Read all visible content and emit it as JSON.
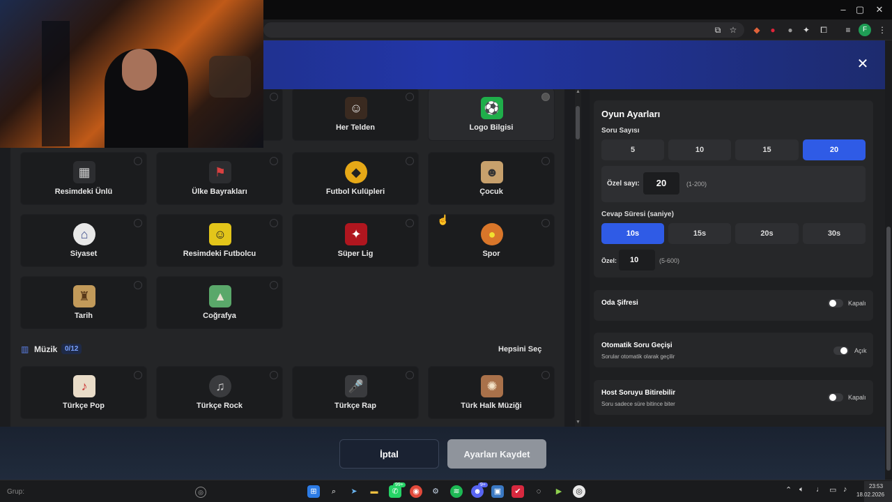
{
  "browser": {
    "window_controls": [
      "–",
      "▢",
      "✕"
    ],
    "tray_icons": [
      "install-icon",
      "star-icon",
      "ext1-icon",
      "ext2-icon",
      "ext3-icon",
      "ext4-icon",
      "puzzle-icon",
      "media-icon",
      "profile-icon",
      "menu-icon"
    ],
    "profile_letter": "F"
  },
  "modal": {
    "close": "✕"
  },
  "categories": {
    "row0": [
      {
        "label": "Her Telden",
        "icon": "person-icon",
        "color": "#3a2a20",
        "glyph": "☺"
      },
      {
        "label": "Logo Bilgisi",
        "icon": "logo-quiz-icon",
        "color": "#1fae4a",
        "glyph": "⚽"
      }
    ],
    "row1": [
      {
        "label": "Resimdeki Ünlü",
        "icon": "building-icon",
        "color": "#2c2d30",
        "glyph": "▦"
      },
      {
        "label": "Ülke Bayrakları",
        "icon": "flag-icon",
        "color": "#2c2d30",
        "glyph": "⚑"
      },
      {
        "label": "Futbol Kulüpleri",
        "icon": "wolf-crest-icon",
        "color": "#e6a817",
        "glyph": "◆"
      },
      {
        "label": "Çocuk",
        "icon": "child-icon",
        "color": "#c7a06c",
        "glyph": "☻"
      }
    ],
    "row2": [
      {
        "label": "Siyaset",
        "icon": "capitol-icon",
        "color": "#e8e8e8",
        "glyph": "⌂"
      },
      {
        "label": "Resimdeki Futbolcu",
        "icon": "footballer-icon",
        "color": "#e3c51a",
        "glyph": "☺"
      },
      {
        "label": "Süper Lig",
        "icon": "super-lig-icon",
        "color": "#b0161f",
        "glyph": "✦"
      },
      {
        "label": "Spor",
        "icon": "sport-balls-icon",
        "color": "#d9762a",
        "glyph": "●"
      }
    ],
    "row3": [
      {
        "label": "Tarih",
        "icon": "colosseum-icon",
        "color": "#c29a5a",
        "glyph": "♜"
      },
      {
        "label": "Coğrafya",
        "icon": "mountain-icon",
        "color": "#5aa86a",
        "glyph": "▲"
      }
    ],
    "music_header": {
      "title": "Müzik",
      "count": "0/12",
      "select_all": "Hepsini Seç"
    },
    "music": [
      {
        "label": "Türkçe Pop",
        "icon": "pop-icon",
        "color": "#e9dcc8",
        "glyph": "♪"
      },
      {
        "label": "Türkçe Rock",
        "icon": "rock-icon",
        "color": "#3a3b3e",
        "glyph": "♫"
      },
      {
        "label": "Türkçe Rap",
        "icon": "microphone-icon",
        "color": "#3a3b3e",
        "glyph": "🎤"
      },
      {
        "label": "Türk Halk Müziği",
        "icon": "folk-icon",
        "color": "#a9714a",
        "glyph": "✺"
      }
    ]
  },
  "settings": {
    "title": "Oyun Ayarları",
    "question_count_label": "Soru Sayısı",
    "question_options": [
      "5",
      "10",
      "15",
      "20"
    ],
    "question_selected": "20",
    "custom_count_label": "Özel sayı:",
    "custom_count_value": "20",
    "custom_count_range": "(1-200)",
    "answer_time_label": "Cevap Süresi (saniye)",
    "time_options": [
      "10s",
      "15s",
      "20s",
      "30s"
    ],
    "time_selected": "10s",
    "custom_time_label": "Özel:",
    "custom_time_value": "10",
    "custom_time_range": "(5-600)",
    "room_password": {
      "label": "Oda Şifresi",
      "state": "Kapalı"
    },
    "auto_next": {
      "label": "Otomatik Soru Geçişi",
      "desc": "Sorular otomatik olarak geçilir",
      "state": "Açık"
    },
    "host_end": {
      "label": "Host Soruyu Bitirebilir",
      "desc": "Soru sadece süre bitince biter",
      "state": "Kapalı"
    }
  },
  "footer": {
    "cancel": "İptal",
    "save": "Ayarları Kaydet"
  },
  "taskbar": {
    "search_placeholder": "Grup:",
    "time": "23:53",
    "date": "18.02.2026",
    "badge_whatsapp": "99+",
    "badge_discord": "9+"
  }
}
